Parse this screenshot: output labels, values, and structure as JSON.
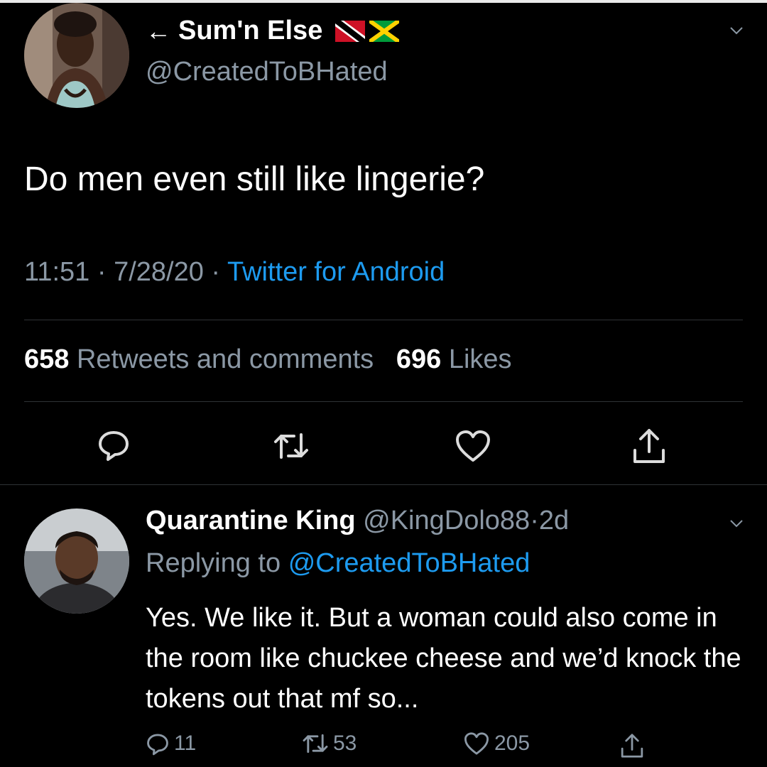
{
  "tweet": {
    "display_name": "Sum'n Else",
    "back_arrow": "←",
    "handle": "@CreatedToBHated",
    "text": "Do men even still like lingerie?",
    "time": "11:51",
    "date": "7/28/20",
    "source": "Twitter for Android",
    "retweets_count": "658",
    "retweets_label": "Retweets and comments",
    "likes_count": "696",
    "likes_label": "Likes"
  },
  "reply": {
    "display_name": "Quarantine King",
    "handle": "@KingDolo88",
    "age": "2d",
    "replying_prefix": "Replying to",
    "replying_to": "@CreatedToBHated",
    "text": "Yes. We like it. But a woman could also come in the room like chuckee cheese and we’d knock the tokens out that mf so...",
    "reply_count": "11",
    "retweet_count": "53",
    "like_count": "205"
  },
  "separators": {
    "dot": "·"
  },
  "colors": {
    "background": "#000000",
    "primary_text": "#ffffff",
    "secondary_text": "#8b98a5",
    "link": "#1d9bf0",
    "divider": "#2f3336"
  },
  "icons": {
    "tweet_actions": [
      "reply-icon",
      "retweet-icon",
      "like-icon",
      "share-icon"
    ],
    "reply_actions": [
      "reply-icon",
      "retweet-icon",
      "like-icon",
      "share-icon"
    ],
    "flags": [
      "trinidad-flag-icon",
      "jamaica-flag-icon"
    ]
  }
}
